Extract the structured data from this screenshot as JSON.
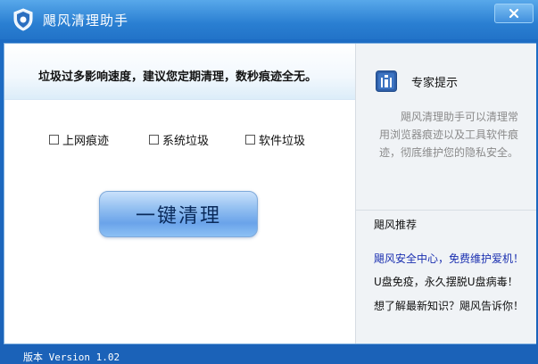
{
  "window": {
    "title": "飓风清理助手",
    "close_label": "×"
  },
  "main": {
    "banner_text": "垃圾过多影响速度，建议您定期清理，数秒痕迹全无。",
    "checkboxes": [
      {
        "label": "上网痕迹",
        "checked": false
      },
      {
        "label": "系统垃圾",
        "checked": false
      },
      {
        "label": "软件垃圾",
        "checked": false
      }
    ],
    "clean_button_label": "一键清理"
  },
  "side_panel": {
    "tip_heading": "专家提示",
    "tip_body": "飓风清理助手可以清理常用浏览器痕迹以及工具软件痕迹，彻底维护您的隐私安全。",
    "recommend_heading": "飓风推荐",
    "recommendations": [
      "飓风安全中心，免费维护爱机！",
      "U盘免疫，永久摆脱U盘病毒！",
      "想了解最新知识？飓风告诉你！"
    ]
  },
  "status": {
    "version_text": "版本 Version 1.02"
  },
  "colors": {
    "title_bar": "#2a7fd2",
    "link_blue": "#1a2fb0",
    "tip_gray": "#8a8a8a"
  },
  "icons": {
    "app": "shield-icon",
    "tip": "info-icon",
    "close": "close-icon"
  }
}
